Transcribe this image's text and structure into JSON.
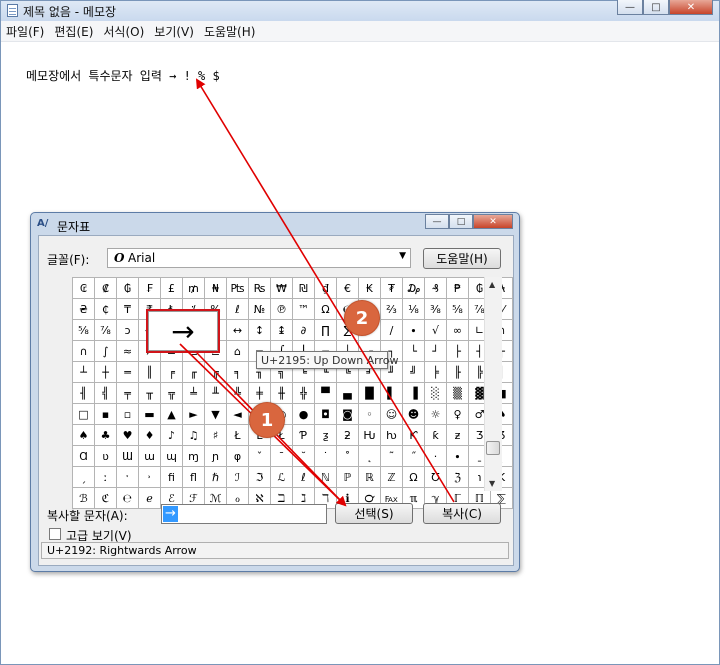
{
  "notepad": {
    "title": "제목 없음 - 메모장",
    "menu": [
      "파일(F)",
      "편집(E)",
      "서식(O)",
      "보기(V)",
      "도움말(H)"
    ],
    "content": "메모장에서 특수문자 입력 → ! % $"
  },
  "window_buttons": {
    "minimize": "—",
    "maximize": "□",
    "close": "✕"
  },
  "charmap": {
    "title": "문자표",
    "icon_text": "A/",
    "font_label": "글꼴(F):",
    "font_icon": "O",
    "font_name": "Arial",
    "help_button": "도움말(H)",
    "rows": [
      [
        "₢",
        "₡",
        "₲",
        "₣",
        "£",
        "₥",
        "₦",
        "₧",
        "₨",
        "₩",
        "₪",
        "₫",
        "€",
        "₭",
        "₮",
        "₯",
        "₰",
        "₱",
        "₲",
        "₳"
      ],
      [
        "₴",
        "₵",
        "₸",
        "₹",
        "₺",
        "⁒",
        "%",
        "ℓ",
        "№",
        "℗",
        "™",
        "Ω",
        "℮",
        "⅓",
        "⅔",
        "⅛",
        "⅜",
        "⅝",
        "⅞",
        "⅟"
      ],
      [
        "⅝",
        "⅞",
        "ↄ",
        "←",
        "↑",
        "→",
        "↓",
        "↔",
        "↕",
        "↨",
        "∂",
        "∏",
        "∑",
        "−",
        "∕",
        "∙",
        "√",
        "∞",
        "∟",
        "∩"
      ],
      [
        "∩",
        "∫",
        "≈",
        "≠",
        "≡",
        "≤",
        "≥",
        "⌂",
        "⌐",
        "⌠",
        "⌡",
        "─",
        "│",
        "┌",
        "┐",
        "└",
        "┘",
        "├",
        "┤",
        "┬"
      ],
      [
        "┴",
        "┼",
        "═",
        "║",
        "╒",
        "╓",
        "╔",
        "╕",
        "╖",
        "╗",
        "╘",
        "╙",
        "╚",
        "╛",
        "╜",
        "╝",
        "╞",
        "╟",
        "╠",
        "╡"
      ],
      [
        "╢",
        "╣",
        "╤",
        "╥",
        "╦",
        "╧",
        "╨",
        "╩",
        "╪",
        "╫",
        "╬",
        "▀",
        "▄",
        "█",
        "▌",
        "▐",
        "░",
        "▒",
        "▓",
        "■"
      ],
      [
        "□",
        "▪",
        "▫",
        "▬",
        "▲",
        "►",
        "▼",
        "◄",
        "◊",
        "○",
        "●",
        "◘",
        "◙",
        "◦",
        "☺",
        "☻",
        "☼",
        "♀",
        "♂",
        "♠"
      ],
      [
        "♠",
        "♣",
        "♥",
        "♦",
        "♪",
        "♫",
        "♯",
        "Ł",
        "Ŀ",
        "Ł",
        "Ƥ",
        "ƺ",
        "ƻ",
        "Ƕ",
        "ƕ",
        "Ƙ",
        "ƙ",
        "ƶ",
        "Ʒ",
        "Ʒ"
      ],
      [
        "Ɑ",
        "ʋ",
        "Ɯ",
        "ɯ",
        "ɰ",
        "ɱ",
        "ɲ",
        "φ",
        "ˇ",
        "ˉ",
        "˘",
        "˙",
        "˚",
        "˛",
        "˜",
        "˝",
        "·",
        "∙",
        "ˍ",
        "ˎ"
      ],
      [
        "ˏ",
        "ː",
        "ˑ",
        "˒",
        "ﬁ",
        "ﬂ",
        "ℏ",
        "ℐ",
        "ℑ",
        "ℒ",
        "ℓ",
        "ℕ",
        "ℙ",
        "ℝ",
        "ℤ",
        "Ω",
        "℧",
        "ℨ",
        "℩",
        "K"
      ],
      [
        "ℬ",
        "ℭ",
        "℮",
        "ℯ",
        "ℰ",
        "ℱ",
        "ℳ",
        "ℴ",
        "ℵ",
        "ℶ",
        "ℷ",
        "ℸ",
        "ℹ",
        "℺",
        "℻",
        "ℼ",
        "ℽ",
        "ℾ",
        "ℿ",
        "⅀"
      ]
    ],
    "zoom_char": "→",
    "tooltip": "U+2195: Up Down Arrow",
    "copy_label": "복사할 문자(A):",
    "copy_value": "→",
    "select_button": "선택(S)",
    "copy_button": "복사(C)",
    "advanced_label": "고급 보기(V)",
    "status": "U+2192: Rightwards Arrow"
  },
  "annotations": {
    "badge1": "1",
    "badge2": "2",
    "color": "#d9663e",
    "arrow_color": "#e00000"
  }
}
